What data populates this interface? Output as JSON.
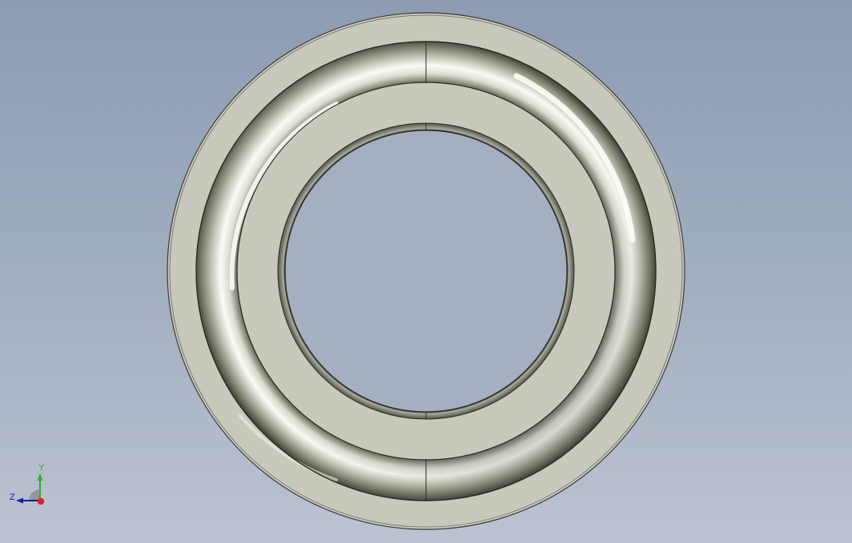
{
  "viewport": {
    "background_top": "#8c9cb3",
    "background_bottom": "#bcc3d2"
  },
  "part": {
    "face_color": "#c8c8bd",
    "edge_color": "#3a3a36",
    "highlight_color": "#fafaf4",
    "shadow_color": "#2c2c22"
  },
  "triad": {
    "y_label": "Y",
    "z_label": "Z",
    "y_color": "#2fae2f",
    "z_color": "#1a1a9c",
    "x_color": "#e02020",
    "icons": [
      "view-triad-icon"
    ]
  }
}
